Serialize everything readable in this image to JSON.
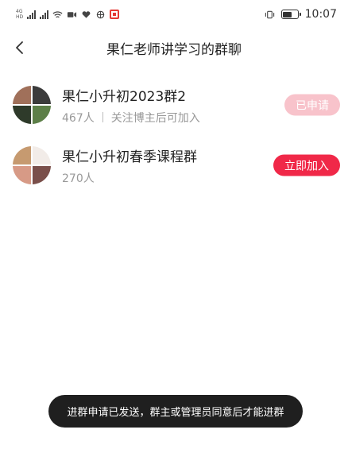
{
  "status_bar": {
    "left_tags": [
      "4G",
      "HD"
    ],
    "time": "10:07",
    "battery_level": 0.7
  },
  "header": {
    "title": "果仁老师讲学习的群聊",
    "back_icon": "chevron-left-icon"
  },
  "groups": [
    {
      "name": "果仁小升初2023群2",
      "members": "467人",
      "condition": "关注博主后可加入",
      "action_label": "已申请",
      "action_state": "applied",
      "avatar_colors": [
        "#a0705a",
        "#3b3b3b",
        "#2e3a2a",
        "#5d7f48"
      ]
    },
    {
      "name": "果仁小升初春季课程群",
      "members": "270人",
      "condition": "",
      "action_label": "立即加入",
      "action_state": "joinable",
      "avatar_colors": [
        "#c69a70",
        "#f2ece8",
        "#d79a86",
        "#7a4f4a"
      ]
    }
  ],
  "toast": {
    "message": "进群申请已发送，群主或管理员同意后才能进群"
  },
  "colors": {
    "accent": "#f02848",
    "accent_disabled": "#f8c3cb",
    "toast_bg": "#1f1f1f"
  }
}
